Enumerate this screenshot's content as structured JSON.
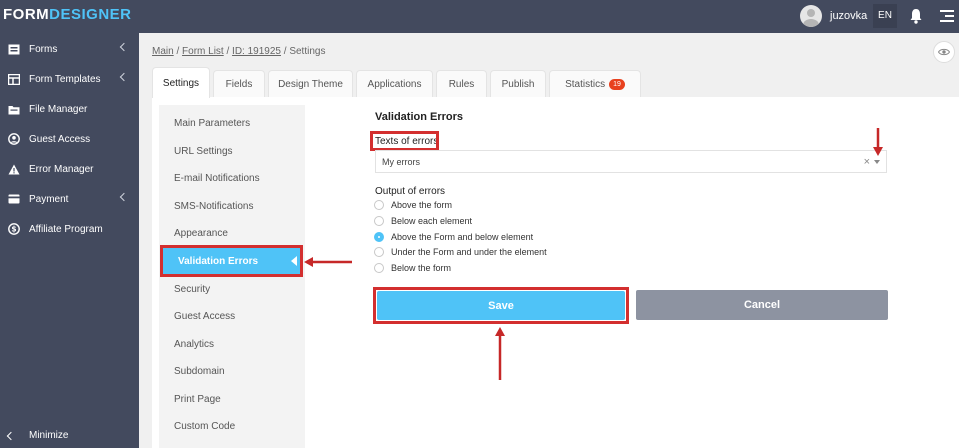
{
  "app": {
    "logo_part1": "FORM",
    "logo_part2": "DESIGNER"
  },
  "header": {
    "username": "juzovka",
    "language": "EN"
  },
  "sidebar": {
    "items": [
      {
        "label": "Forms",
        "icon": "forms-icon",
        "has_submenu": true
      },
      {
        "label": "Form Templates",
        "icon": "templates-icon",
        "has_submenu": true
      },
      {
        "label": "File Manager",
        "icon": "file-manager-icon",
        "has_submenu": false
      },
      {
        "label": "Guest Access",
        "icon": "user-circle-icon",
        "has_submenu": false
      },
      {
        "label": "Error Manager",
        "icon": "warning-icon",
        "has_submenu": false
      },
      {
        "label": "Payment",
        "icon": "credit-card-icon",
        "has_submenu": true
      },
      {
        "label": "Affiliate Program",
        "icon": "dollar-icon",
        "has_submenu": false
      }
    ],
    "minimize_label": "Minimize"
  },
  "breadcrumb": {
    "main": "Main",
    "form_list": "Form List",
    "form_id": "ID: 191925",
    "current": "Settings",
    "sep": " / "
  },
  "tabs": [
    {
      "label": "Settings",
      "active": true
    },
    {
      "label": "Fields"
    },
    {
      "label": "Design Theme"
    },
    {
      "label": "Applications"
    },
    {
      "label": "Rules"
    },
    {
      "label": "Publish"
    },
    {
      "label": "Statistics",
      "badge": "19"
    }
  ],
  "settings_nav": [
    "Main Parameters",
    "URL Settings",
    "E-mail Notifications",
    "SMS-Notifications",
    "Appearance",
    "Validation Errors",
    "Security",
    "Guest Access",
    "Analytics",
    "Subdomain",
    "Print Page",
    "Custom Code"
  ],
  "settings_nav_active_index": 5,
  "validation": {
    "title": "Validation Errors",
    "texts_label": "Texts of errors",
    "texts_value": "My errors",
    "clear_glyph": "×",
    "output_label": "Output of errors",
    "options": [
      "Above the form",
      "Below each element",
      "Above the Form and below element",
      "Under the Form and under the element",
      "Below the form"
    ],
    "selected_index": 2
  },
  "buttons": {
    "save": "Save",
    "cancel": "Cancel"
  },
  "colors": {
    "topbar": "#434a5e",
    "accent": "#4fc3f7",
    "highlight": "#d32f2f",
    "badge": "#e8411e",
    "cancel": "#8d93a1"
  }
}
